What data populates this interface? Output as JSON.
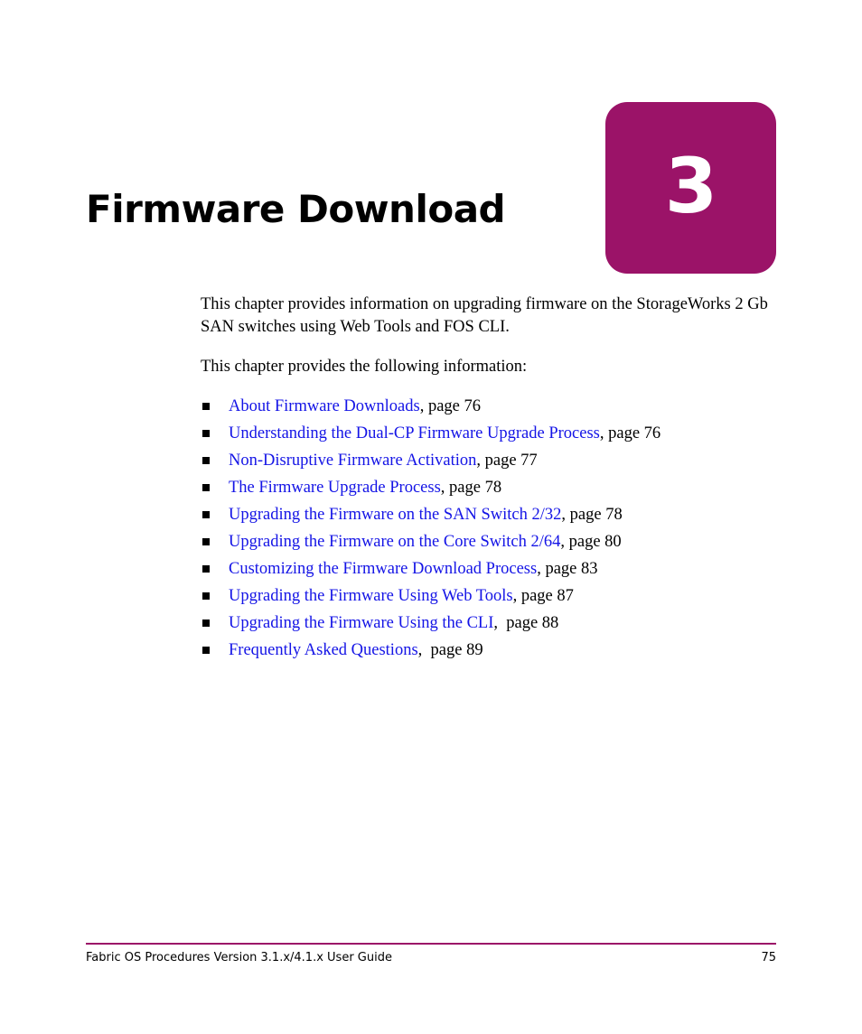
{
  "document": {
    "chapter_number": "3",
    "chapter_title": "Firmware Download",
    "accent_color": "#9B1368",
    "link_color": "#1414E6"
  },
  "intro": {
    "paragraph_1": "This chapter provides information on upgrading firmware on the StorageWorks 2 Gb SAN switches using Web Tools and FOS CLI.",
    "paragraph_2": "This chapter provides the following information:"
  },
  "toc": {
    "items": [
      {
        "link": "About Firmware Downloads",
        "page_ref": ", page 76"
      },
      {
        "link": "Understanding the Dual-CP Firmware Upgrade Process",
        "page_ref": ", page 76"
      },
      {
        "link": "Non-Disruptive Firmware Activation",
        "page_ref": ", page 77"
      },
      {
        "link": "The Firmware Upgrade Process",
        "page_ref": ", page 78"
      },
      {
        "link": "Upgrading the Firmware on the SAN Switch 2/32",
        "page_ref": ", page 78"
      },
      {
        "link": "Upgrading the Firmware on the Core Switch 2/64",
        "page_ref": ", page 80"
      },
      {
        "link": "Customizing the Firmware Download Process",
        "page_ref": ", page 83"
      },
      {
        "link": "Upgrading the Firmware Using Web Tools",
        "page_ref": ", page 87"
      },
      {
        "link": "Upgrading the Firmware Using the CLI",
        "page_ref": ",  page 88"
      },
      {
        "link": "Frequently Asked Questions",
        "page_ref": ",  page 89"
      }
    ]
  },
  "footer": {
    "guide_title": "Fabric OS Procedures Version 3.1.x/4.1.x User Guide",
    "page_number": "75"
  }
}
